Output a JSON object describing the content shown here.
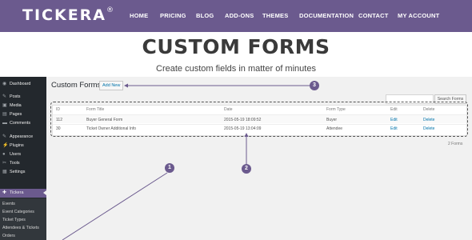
{
  "site": {
    "logo": "TICKERA",
    "logo_mark": "®",
    "nav": [
      "HOME",
      "PRICING",
      "BLOG",
      "ADD-ONS",
      "THEMES",
      "DOCUMENTATION",
      "CONTACT",
      "MY ACCOUNT"
    ]
  },
  "hero": {
    "title": "CUSTOM FORMS",
    "subtitle": "Create custom fields in matter of minutes"
  },
  "admin": {
    "sidebar": {
      "items": [
        {
          "label": "Dashboard",
          "icon": "dashboard-icon",
          "glyph": "◉"
        },
        {
          "label": "Posts",
          "icon": "pin-icon",
          "glyph": "✎"
        },
        {
          "label": "Media",
          "icon": "media-icon",
          "glyph": "▣"
        },
        {
          "label": "Pages",
          "icon": "pages-icon",
          "glyph": "▤"
        },
        {
          "label": "Comments",
          "icon": "comments-icon",
          "glyph": "▬"
        },
        {
          "label": "Appearance",
          "icon": "brush-icon",
          "glyph": "✎"
        },
        {
          "label": "Plugins",
          "icon": "plugin-icon",
          "glyph": "⚡"
        },
        {
          "label": "Users",
          "icon": "users-icon",
          "glyph": "●"
        },
        {
          "label": "Tools",
          "icon": "wrench-icon",
          "glyph": "✂"
        },
        {
          "label": "Settings",
          "icon": "settings-icon",
          "glyph": "▦"
        },
        {
          "label": "Tickera",
          "icon": "ticket-icon",
          "glyph": "✚",
          "active": true
        }
      ],
      "submenu": [
        "Events",
        "Event Categories",
        "Ticket Types",
        "Attendees & Tickets",
        "Orders"
      ]
    },
    "page_title": "Custom Forms",
    "add_new_label": "Add New",
    "search_button": "Search Forms",
    "search_value": "",
    "table": {
      "columns": [
        "ID",
        "Form Title",
        "Date",
        "Form Type",
        "Edit",
        "Delete"
      ],
      "rows": [
        [
          "112",
          "Buyer General Form",
          "2015-05-19 18:09:52",
          "Buyer",
          "Edit",
          "Delete"
        ],
        [
          "30",
          "Ticket Owner Additional Info",
          "2015-05-19 13:04:09",
          "Attendee",
          "Edit",
          "Delete"
        ]
      ]
    },
    "count_label": "2 Forms"
  },
  "annotations": [
    "1",
    "2",
    "3"
  ],
  "colors": {
    "brand": "#6b5a8e",
    "sidebar": "#23282d",
    "link": "#0073aa"
  }
}
